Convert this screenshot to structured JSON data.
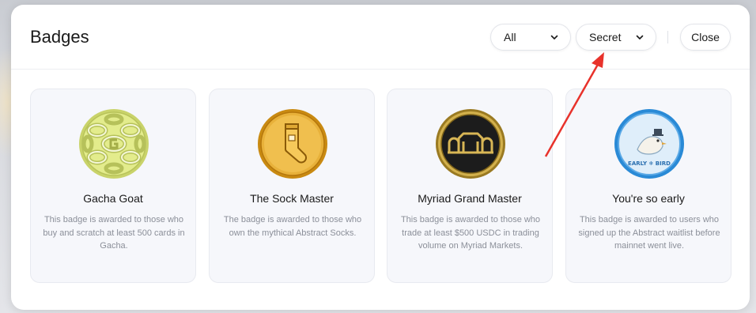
{
  "modal": {
    "title": "Badges",
    "filter_all": "All",
    "filter_secret": "Secret",
    "close_label": "Close"
  },
  "badges": [
    {
      "title": "Gacha Goat",
      "description": "This badge is awarded to those who buy and scratch at least 500 cards in Gacha.",
      "icon": "gacha-goat-badge-icon"
    },
    {
      "title": "The Sock Master",
      "description": "The badge is awarded to those who own the mythical Abstract Socks.",
      "icon": "sock-master-badge-icon"
    },
    {
      "title": "Myriad Grand Master",
      "description": "This badge is awarded to those who trade at least $500 USDC in trading volume on Myriad Markets.",
      "icon": "myriad-grand-master-badge-icon"
    },
    {
      "title": "You're so early",
      "description": "This badge is awarded to users who signed up the Abstract waitlist before mainnet went live.",
      "icon": "early-bird-badge-icon",
      "badge_text": "EARLY BIRD"
    }
  ],
  "colors": {
    "annotation_arrow": "#e8322b",
    "card_bg": "#f6f7fb",
    "muted_text": "#8b8f99"
  }
}
